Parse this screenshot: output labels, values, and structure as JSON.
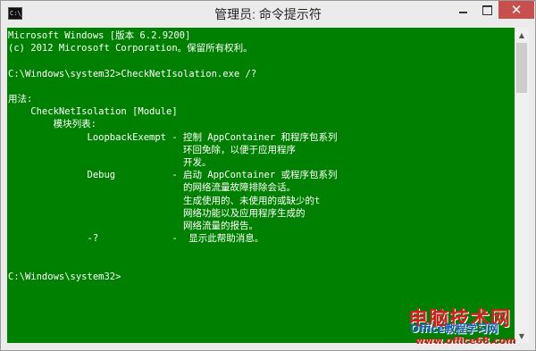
{
  "window": {
    "title": "管理员: 命令提示符",
    "icon_label": "C:\\_",
    "close_glyph": "✕"
  },
  "console": {
    "lines": [
      "Microsoft Windows [版本 6.2.9200]",
      "(c) 2012 Microsoft Corporation。保留所有权利。",
      "",
      "C:\\Windows\\system32>CheckNetIsolation.exe /?",
      "",
      "用法:",
      "    CheckNetIsolation [Module]",
      "        模块列表:",
      "              LoopbackExempt - 控制 AppContainer 和程序包系列",
      "                               环回免除，以便于应用程序",
      "                               开发。",
      "              Debug          - 启动 AppContainer 或程序包系列",
      "                               的网络流量故障排除会话。",
      "                               生成使用的、未使用的或缺少的t",
      "                               网络功能以及应用程序生成的",
      "                               网络流量的报告。",
      "              -?             -  显示此帮助消息。",
      "",
      "",
      "C:\\Windows\\system32>"
    ]
  },
  "watermark": {
    "top": "电脑技术网",
    "middle": "Office教程学习网",
    "url": "www.office68.com"
  },
  "colors": {
    "console_bg": "#008000",
    "console_fg": "#ffffff",
    "close_button": "#c7504f"
  }
}
